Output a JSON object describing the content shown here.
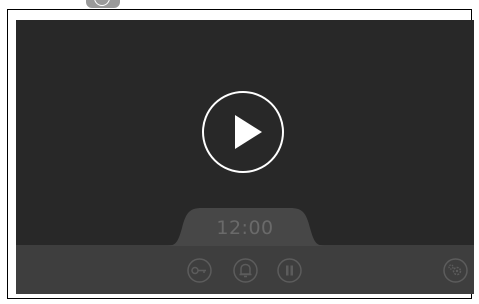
{
  "player": {
    "time": "12:00"
  },
  "controls": {
    "play_icon": "play-icon",
    "key_icon": "key-icon",
    "bell_icon": "bell-icon",
    "pause_icon": "pause-icon",
    "settings_icon": "gear-icon"
  },
  "colors": {
    "screen": "#282828",
    "bar": "#3e3e3e",
    "tab": "#474747",
    "icon_dim": "#5c5c5c",
    "time_text": "#6a6a6a",
    "play_ring": "#ffffff"
  }
}
